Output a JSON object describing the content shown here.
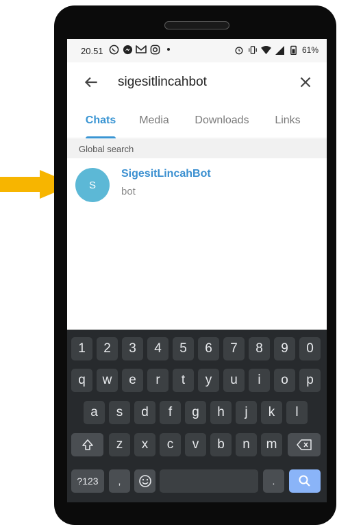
{
  "status": {
    "time": "20.51",
    "battery": "61%"
  },
  "search": {
    "query": "sigesitlincahbot"
  },
  "tabs": [
    {
      "label": "Chats"
    },
    {
      "label": "Media"
    },
    {
      "label": "Downloads"
    },
    {
      "label": "Links"
    }
  ],
  "section_header": "Global search",
  "results": [
    {
      "avatar_letter": "S",
      "name": "SigesitLincahBot",
      "subtitle": "bot"
    }
  ],
  "keyboard": {
    "row1": [
      "1",
      "2",
      "3",
      "4",
      "5",
      "6",
      "7",
      "8",
      "9",
      "0"
    ],
    "row2": [
      "q",
      "w",
      "e",
      "r",
      "t",
      "y",
      "u",
      "i",
      "o",
      "p"
    ],
    "row3": [
      "a",
      "s",
      "d",
      "f",
      "g",
      "h",
      "j",
      "k",
      "l"
    ],
    "row4": [
      "z",
      "x",
      "c",
      "v",
      "b",
      "n",
      "m"
    ],
    "symbols_label": "?123",
    "comma": ",",
    "period": "."
  },
  "colors": {
    "accent": "#3a95d3",
    "avatar": "#5cb8d6",
    "arrow": "#f7b500",
    "keyboard_bg": "#272a2d",
    "enter_key": "#8ab4f8"
  }
}
